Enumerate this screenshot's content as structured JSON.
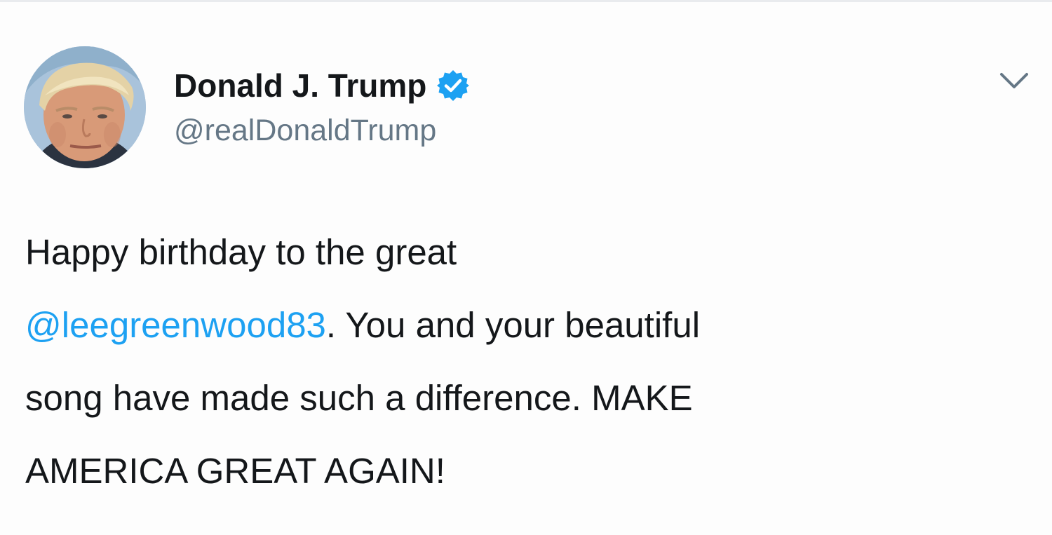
{
  "tweet": {
    "author": {
      "display_name": "Donald J. Trump",
      "handle": "@realDonaldTrump",
      "verified_icon": "verified-badge-icon",
      "avatar": "profile-photo"
    },
    "menu_icon": "chevron-down-icon",
    "body": {
      "line1": "Happy birthday to the great",
      "mention": "@leegreenwood83",
      "line2_rest": ". You and your beautiful",
      "line3": "song have made such a difference. MAKE",
      "line4": "AMERICA GREAT AGAIN!"
    }
  },
  "colors": {
    "text": "#14171a",
    "handle": "#657786",
    "mention": "#1da1f2",
    "verified": "#1da1f2",
    "caret": "#657786"
  }
}
